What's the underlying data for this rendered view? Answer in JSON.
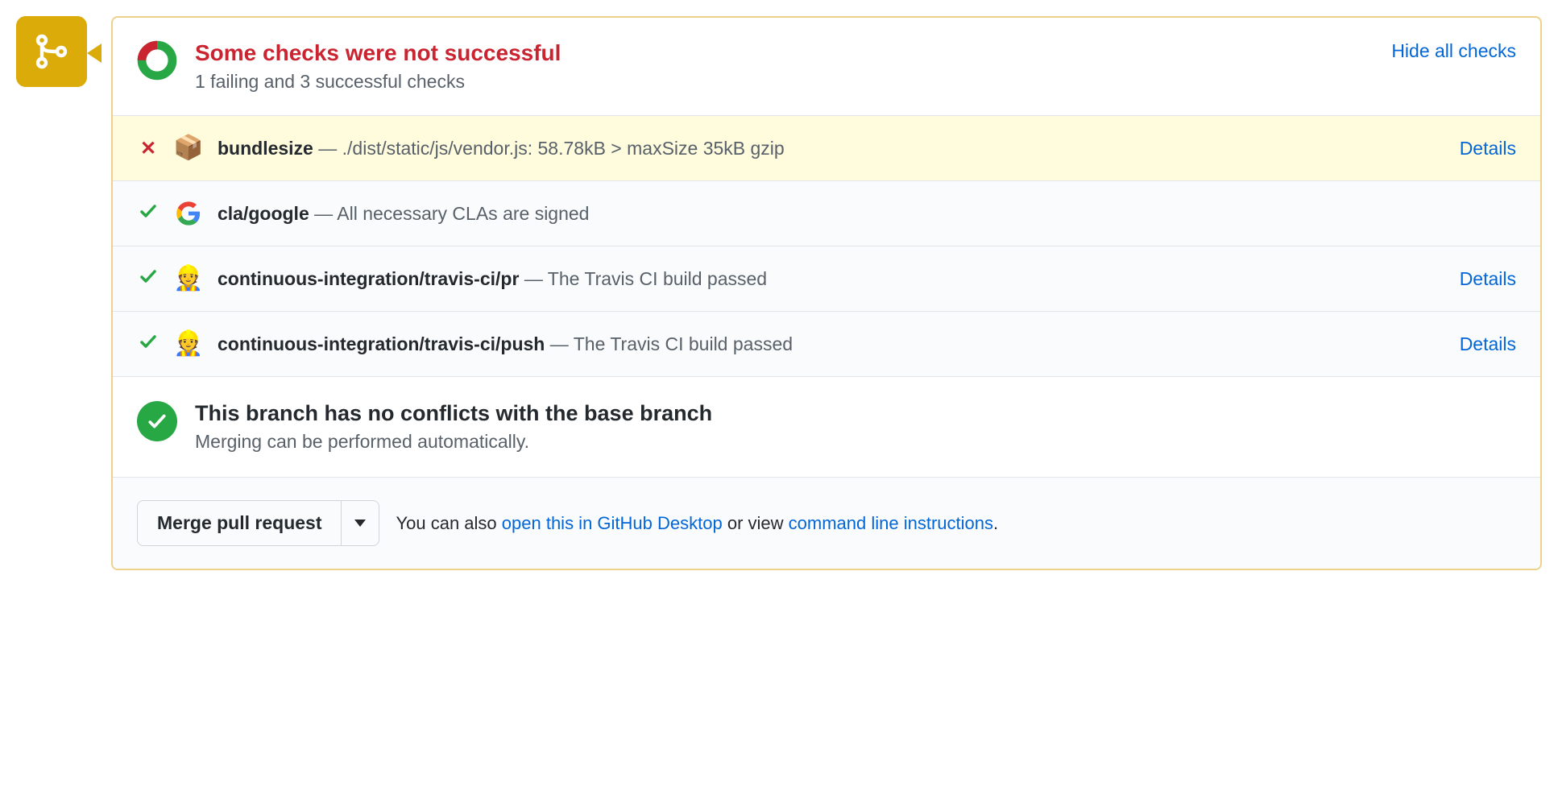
{
  "header": {
    "title": "Some checks were not successful",
    "subtitle": "1 failing and 3 successful checks",
    "toggle_label": "Hide all checks"
  },
  "checks": [
    {
      "status": "fail",
      "avatar": "package",
      "name": "bundlesize",
      "desc": "./dist/static/js/vendor.js: 58.78kB > maxSize 35kB gzip",
      "details": "Details"
    },
    {
      "status": "pass",
      "avatar": "google",
      "name": "cla/google",
      "desc": "All necessary CLAs are signed",
      "details": ""
    },
    {
      "status": "pass",
      "avatar": "travis",
      "name": "continuous-integration/travis-ci/pr",
      "desc": "The Travis CI build passed",
      "details": "Details"
    },
    {
      "status": "pass",
      "avatar": "travis",
      "name": "continuous-integration/travis-ci/push",
      "desc": "The Travis CI build passed",
      "details": "Details"
    }
  ],
  "conflicts": {
    "title": "This branch has no conflicts with the base branch",
    "subtitle": "Merging can be performed automatically."
  },
  "footer": {
    "merge_label": "Merge pull request",
    "prefix": "You can also ",
    "link1": "open this in GitHub Desktop",
    "mid": " or view ",
    "link2": "command line instructions",
    "suffix": "."
  }
}
